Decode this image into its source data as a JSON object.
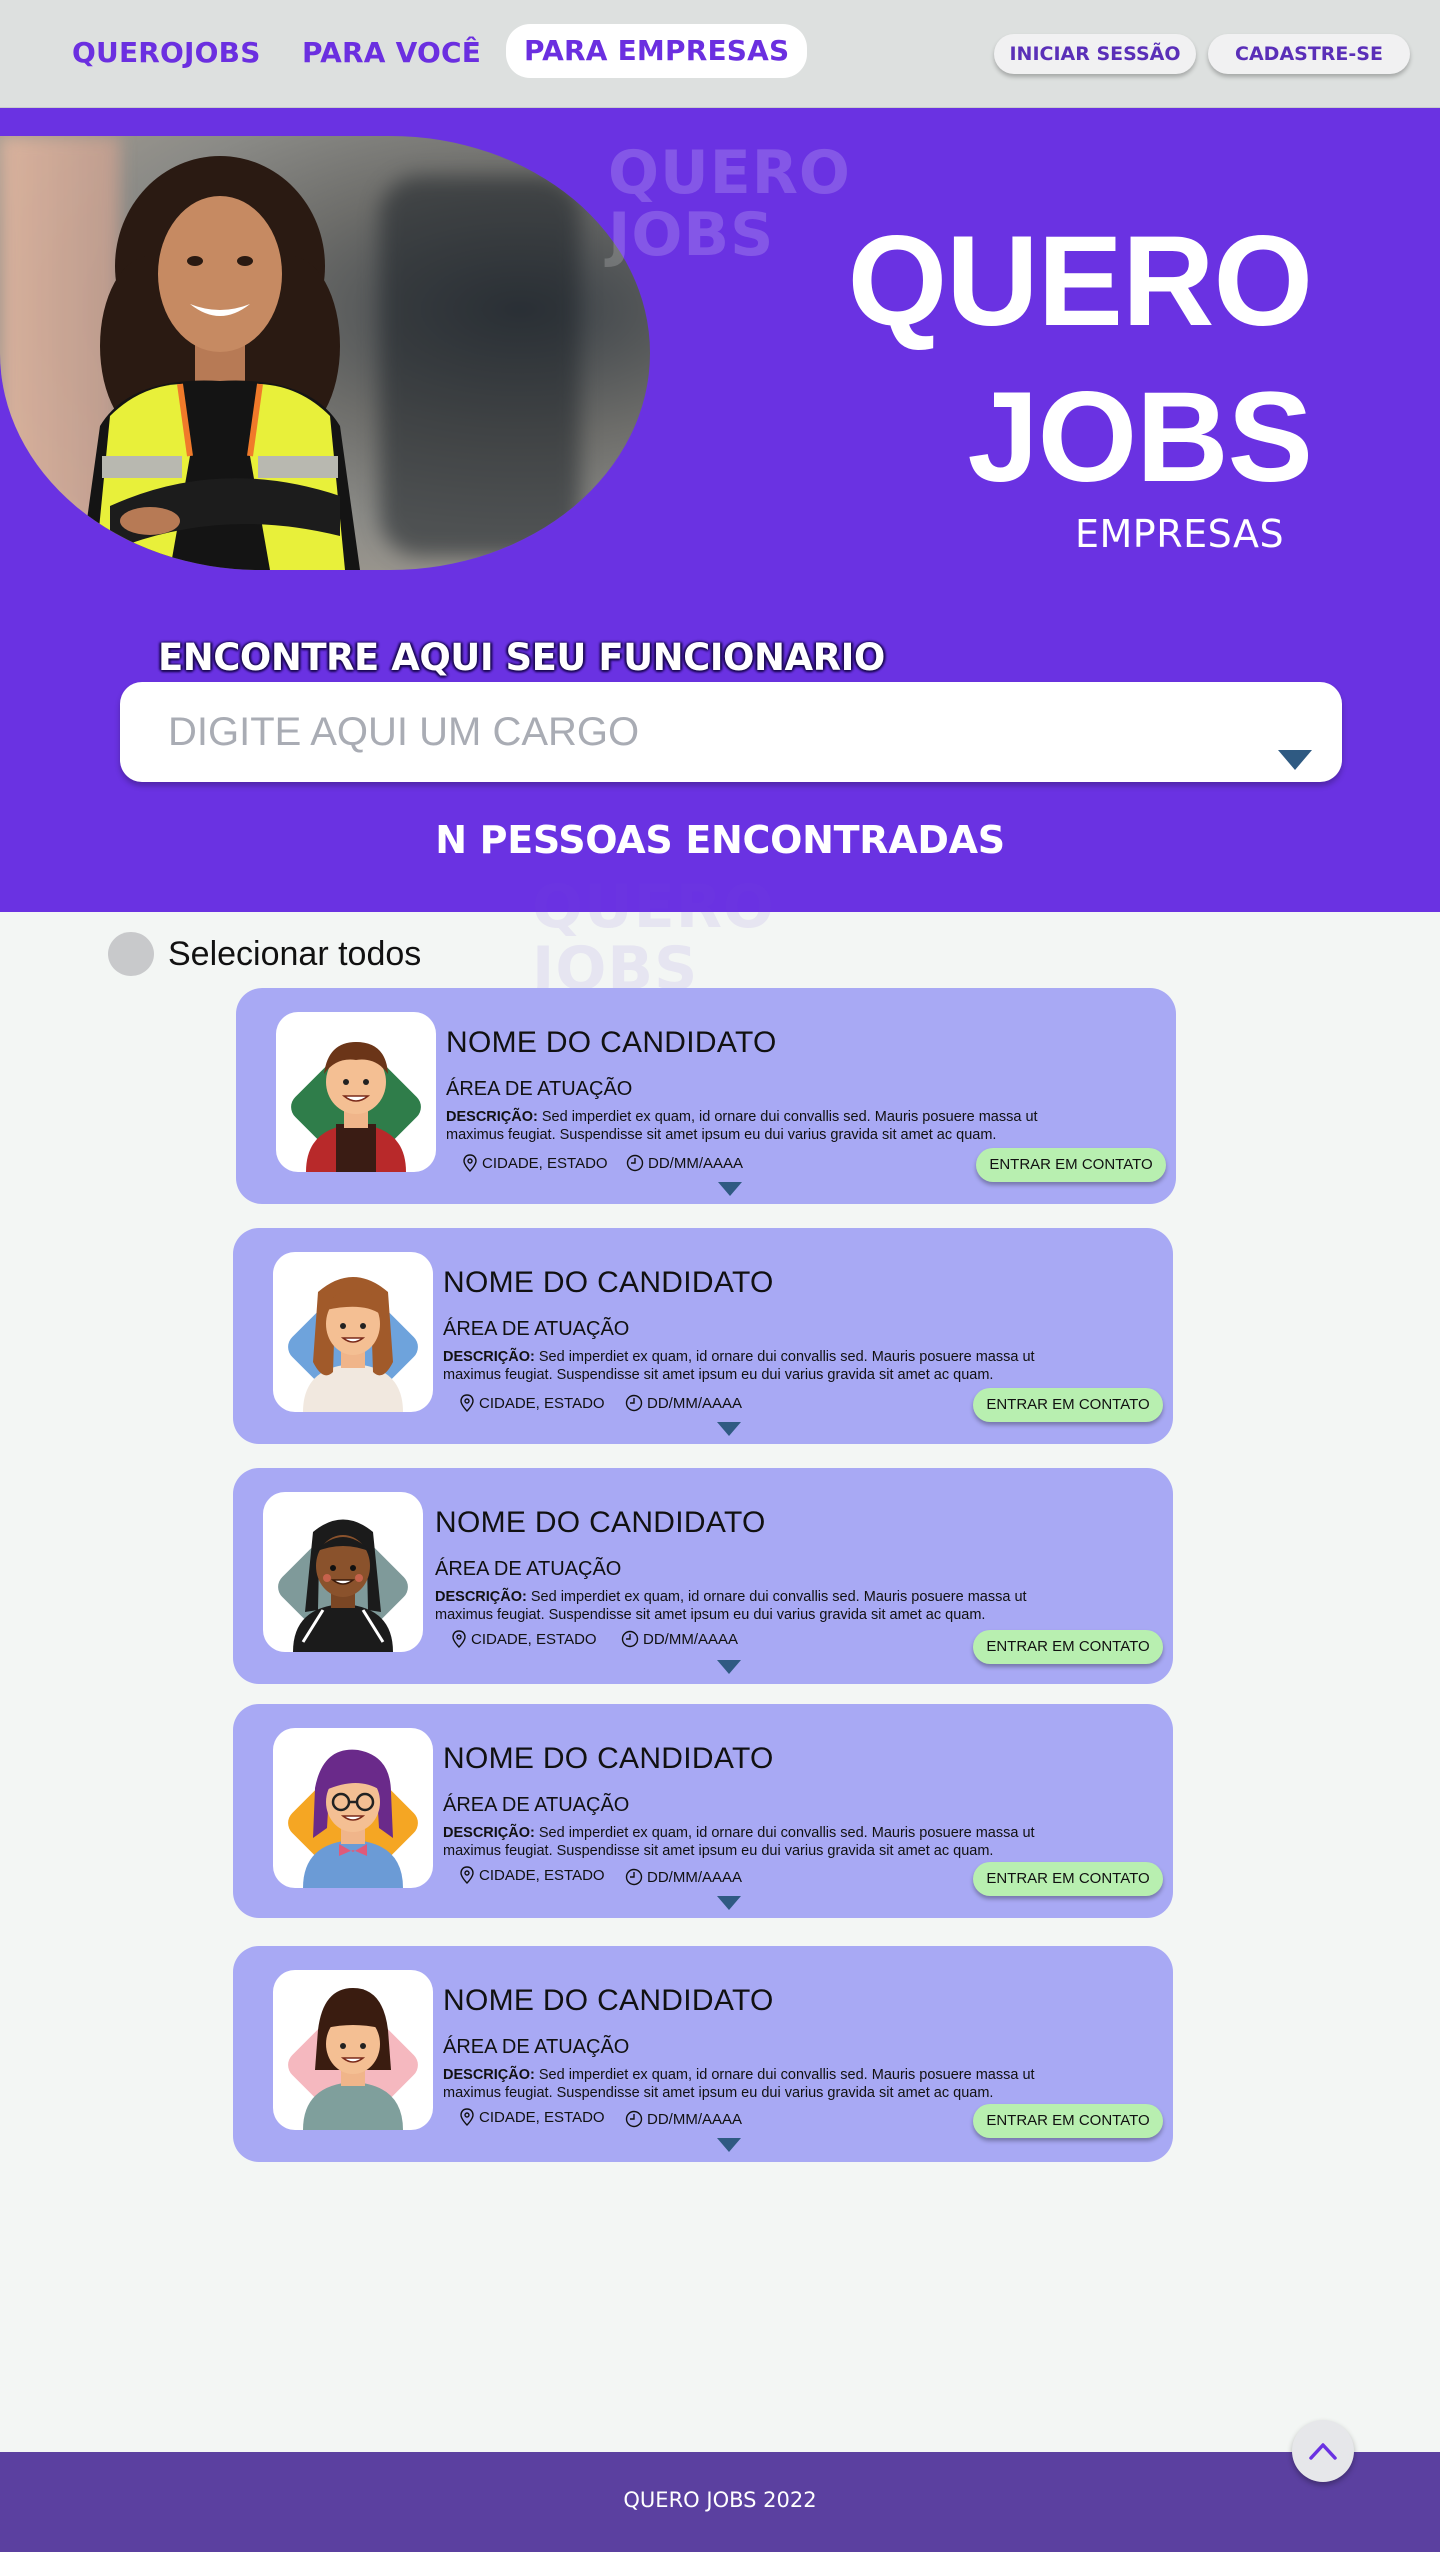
{
  "nav": {
    "links": [
      {
        "label": "QUEROJOBS"
      },
      {
        "label": "PARA VOCÊ"
      },
      {
        "label": "PARA EMPRESAS",
        "active": true
      }
    ],
    "login_label": "INICIAR SESSÃO",
    "signup_label": "CADASTRE-SE"
  },
  "hero": {
    "watermark_line1": "QUERO",
    "watermark_line2": "JOBS",
    "brand_line1": "QUERO",
    "brand_line2": "JOBS",
    "brand_sub": "EMPRESAS",
    "search_title": "ENCONTRE AQUI SEU FUNCIONARIO",
    "search_placeholder": "DIGITE AQUI UM CARGO",
    "result_count": "N PESSOAS ENCONTRADAS"
  },
  "list": {
    "select_all_label": "Selecionar todos",
    "candidates": [
      {
        "name": "NOME DO CANDIDATO",
        "area": "ÁREA DE ATUAÇÃO",
        "desc_label": "DESCRIÇÃO:",
        "desc": " Sed imperdiet ex quam, id ornare dui convallis sed. Mauris posuere massa ut maximus feugiat. Suspendisse sit amet ipsum eu dui varius gravida sit amet ac quam.",
        "location": "CIDADE, ESTADO",
        "date": "DD/MM/AAAA",
        "contact_label": "ENTRAR EM CONTATO"
      },
      {
        "name": "NOME DO CANDIDATO",
        "area": "ÁREA DE ATUAÇÃO",
        "desc_label": "DESCRIÇÃO:",
        "desc": " Sed imperdiet ex quam, id ornare dui convallis sed. Mauris posuere massa ut maximus feugiat. Suspendisse sit amet ipsum eu dui varius gravida sit amet ac quam.",
        "location": "CIDADE, ESTADO",
        "date": "DD/MM/AAAA",
        "contact_label": "ENTRAR EM CONTATO"
      },
      {
        "name": "NOME DO CANDIDATO",
        "area": "ÁREA DE ATUAÇÃO",
        "desc_label": "DESCRIÇÃO:",
        "desc": " Sed imperdiet ex quam, id ornare dui convallis sed. Mauris posuere massa ut maximus feugiat. Suspendisse sit amet ipsum eu dui varius gravida sit amet ac quam.",
        "location": "CIDADE, ESTADO",
        "date": "DD/MM/AAAA",
        "contact_label": "ENTRAR EM CONTATO"
      },
      {
        "name": "NOME DO CANDIDATO",
        "area": "ÁREA DE ATUAÇÃO",
        "desc_label": "DESCRIÇÃO:",
        "desc": " Sed imperdiet ex quam, id ornare dui convallis sed. Mauris posuere massa ut maximus feugiat. Suspendisse sit amet ipsum eu dui varius gravida sit amet ac quam.",
        "location": "CIDADE, ESTADO",
        "date": "DD/MM/AAAA",
        "contact_label": "ENTRAR EM CONTATO"
      },
      {
        "name": "NOME DO CANDIDATO",
        "area": "ÁREA DE ATUAÇÃO",
        "desc_label": "DESCRIÇÃO:",
        "desc": " Sed imperdiet ex quam, id ornare dui convallis sed. Mauris posuere massa ut maximus feugiat. Suspendisse sit amet ipsum eu dui varius gravida sit amet ac quam.",
        "location": "CIDADE, ESTADO",
        "date": "DD/MM/AAAA",
        "contact_label": "ENTRAR EM CONTATO"
      }
    ]
  },
  "footer": {
    "text": "QUERO JOBS 2022"
  },
  "colors": {
    "brand_purple": "#6a32e2",
    "card_bg": "#a8a9f4",
    "contact_button": "#b8efb0",
    "footer_bg": "#5b40a0",
    "nav_bg": "#dde0df"
  },
  "icons": {
    "location": "map-pin-icon",
    "date": "clock-icon",
    "expand": "caret-down-icon",
    "back_to_top": "chevron-up-icon"
  }
}
